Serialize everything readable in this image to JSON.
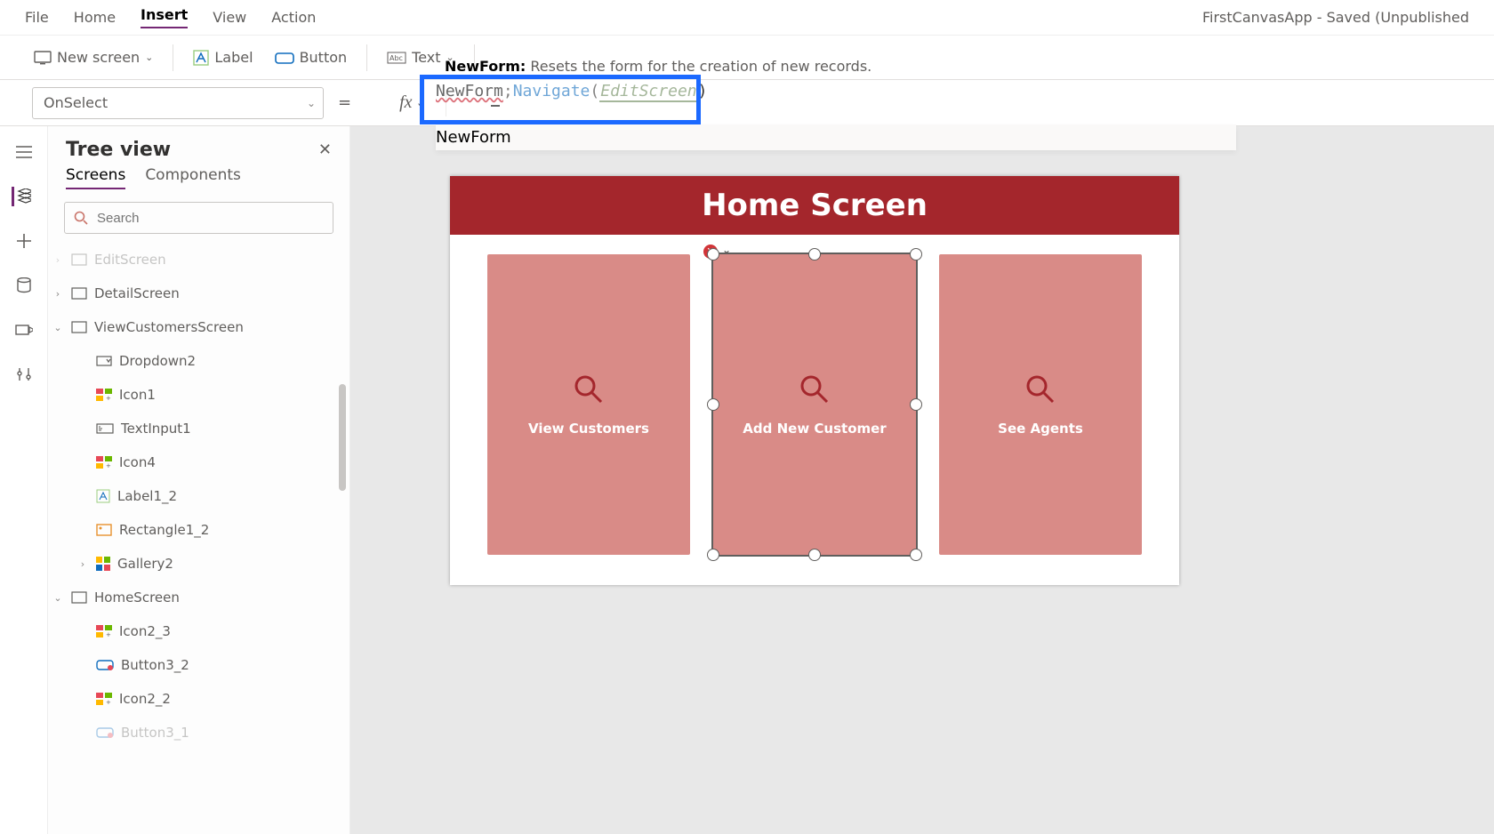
{
  "menu": {
    "items": [
      "File",
      "Home",
      "Insert",
      "View",
      "Action"
    ],
    "active_index": 2,
    "app_title": "FirstCanvasApp - Saved (Unpublished"
  },
  "ribbon": {
    "new_screen": "New screen",
    "label": "Label",
    "button": "Button",
    "text": "Text",
    "hint_name": "NewForm:",
    "hint_text": "Resets the form for the creation of new records."
  },
  "propbar": {
    "selected_property": "OnSelect",
    "fx_label": "fx"
  },
  "formula": {
    "part1": "NewForm",
    "semi": ";",
    "part2": "Navigate",
    "open": "(",
    "arg": "EditScreen",
    "close": ")",
    "intellisense": "NewForm"
  },
  "tree": {
    "title": "Tree view",
    "tabs": [
      "Screens",
      "Components"
    ],
    "search_placeholder": "Search",
    "items": [
      {
        "indent": 0,
        "chev": "›",
        "icon": "screen",
        "label": "EditScreen",
        "truncated_top": true
      },
      {
        "indent": 0,
        "chev": "›",
        "icon": "screen",
        "label": "DetailScreen"
      },
      {
        "indent": 0,
        "chev": "v",
        "icon": "screen",
        "label": "ViewCustomersScreen"
      },
      {
        "indent": 1,
        "chev": "",
        "icon": "dropdown",
        "label": "Dropdown2"
      },
      {
        "indent": 1,
        "chev": "",
        "icon": "iconset",
        "label": "Icon1"
      },
      {
        "indent": 1,
        "chev": "",
        "icon": "textinput",
        "label": "TextInput1"
      },
      {
        "indent": 1,
        "chev": "",
        "icon": "iconset",
        "label": "Icon4"
      },
      {
        "indent": 1,
        "chev": "",
        "icon": "label",
        "label": "Label1_2"
      },
      {
        "indent": 1,
        "chev": "",
        "icon": "rect",
        "label": "Rectangle1_2"
      },
      {
        "indent": 1,
        "chev": "›",
        "icon": "gallery",
        "label": "Gallery2"
      },
      {
        "indent": 0,
        "chev": "v",
        "icon": "screen",
        "label": "HomeScreen"
      },
      {
        "indent": 1,
        "chev": "",
        "icon": "iconset",
        "label": "Icon2_3"
      },
      {
        "indent": 1,
        "chev": "",
        "icon": "btncolor",
        "label": "Button3_2"
      },
      {
        "indent": 1,
        "chev": "",
        "icon": "iconset",
        "label": "Icon2_2"
      },
      {
        "indent": 1,
        "chev": "",
        "icon": "btncolor",
        "label": "Button3_1",
        "faded": true
      }
    ]
  },
  "canvas": {
    "header": "Home Screen",
    "tiles": [
      {
        "label": "View Customers"
      },
      {
        "label": "Add New Customer",
        "selected": true
      },
      {
        "label": "See Agents"
      }
    ]
  }
}
